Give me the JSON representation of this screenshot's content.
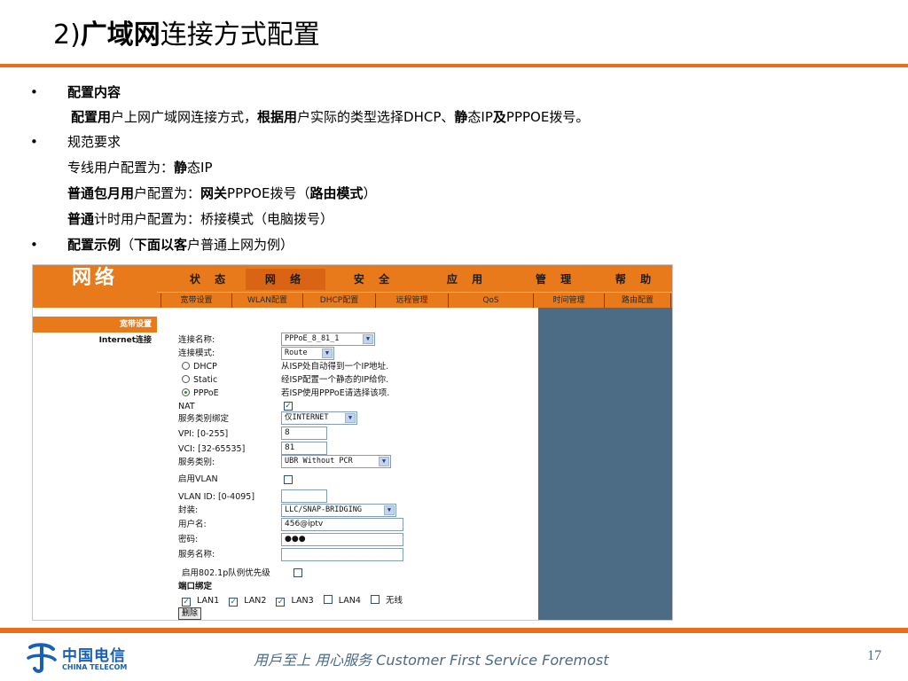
{
  "slide": {
    "title_part1": "2)",
    "title_part2": "广域网",
    "title_part3": "连接方式配置"
  },
  "bullets": {
    "item1_label": "配置内容",
    "item1_text_bold1": "配置用",
    "item1_text_1": "户上网广域网连接方式，",
    "item1_text_bold2": "根据用",
    "item1_text_2": "户实际的类型选择DHCP、",
    "item1_text_bold3": "静",
    "item1_text_3": "态IP",
    "item1_text_bold4": "及",
    "item1_text_4": "PPPOE拨号。",
    "item2_label": "规范要求",
    "item2_line1_a": "专线用户配置为：",
    "item2_line1_b": "静",
    "item2_line1_c": "态IP",
    "item2_line2_bold": "普通包月用",
    "item2_line2_a": "户配置为：",
    "item2_line2_b": "网关",
    "item2_line2_c": "PPPOE拨号（",
    "item2_line2_d": "路由模式",
    "item2_line2_e": "）",
    "item2_line3_bold": "普通",
    "item2_line3_a": "计时用户配置为：桥接模式（电脑拨号）",
    "item3_bold": "配置示例",
    "item3_a": "（",
    "item3_bold2": "下面以客",
    "item3_b": "户普通上网为例）",
    "bullet_char": "•"
  },
  "router": {
    "brand": "网络",
    "tabs": [
      "状 态",
      "网 络",
      "安 全",
      "应 用",
      "管 理",
      "帮 助"
    ],
    "subtabs": [
      "宽带设置",
      "WLAN配置",
      "DHCP配置",
      "远程管理",
      "QoS",
      "时间管理",
      "路由配置"
    ],
    "left_header": "宽带设置",
    "left_item": "Internet连接",
    "form": {
      "conn_name_label": "连接名称:",
      "conn_name_value": "PPPoE_8_81_1",
      "mode_label": "连接模式:",
      "mode_value": "Route",
      "dhcp_label": "DHCP",
      "dhcp_desc": "从ISP处自动得到一个IP地址.",
      "static_label": "Static",
      "static_desc": "经ISP配置一个静态的IP给你.",
      "pppoe_label": "PPPoE",
      "pppoe_desc": "若ISP使用PPPoE请选择该项.",
      "nat_label": "NAT",
      "service_bind_label": "服务类别绑定",
      "service_bind_value": "仅INTERNET",
      "vpi_label": "VPI: [0-255]",
      "vpi_value": "8",
      "vci_label": "VCI: [32-65535]",
      "vci_value": "81",
      "service_type_label": "服务类别:",
      "service_type_value": "UBR Without PCR",
      "vlan_enable_label": "启用VLAN",
      "vlan_id_label": "VLAN ID: [0-4095]",
      "encap_label": "封装:",
      "encap_value": "LLC/SNAP-BRIDGING",
      "username_label": "用户名:",
      "username_value": "456@iptv",
      "password_label": "密码:",
      "password_value": "●●●",
      "service_name_label": "服务名称:",
      "priority_label": "启用802.1p队例优先级",
      "port_bind_label": "端口绑定",
      "lan_ports": [
        "LAN1",
        "LAN2",
        "LAN3",
        "LAN4",
        "无线"
      ],
      "lan_checked": [
        true,
        true,
        true,
        false,
        false
      ],
      "delete_label": "删除",
      "check_mark": "✓",
      "arrow": "▼"
    }
  },
  "footer": {
    "logo_cn": "中国电信",
    "logo_en": "CHINA TELECOM",
    "slogan": "用戶至上  用心服务 Customer First Service Foremost",
    "page_number": "17"
  },
  "colors": {
    "accent_orange": "#e8701a",
    "router_panel_blue": "#4b6c84",
    "brand_blue": "#1a5fb4"
  }
}
